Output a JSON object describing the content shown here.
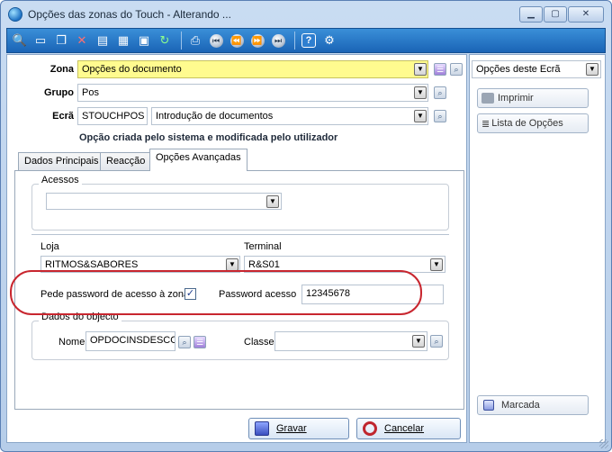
{
  "window": {
    "title": "Opções das zonas do Touch - Alterando ...",
    "minimize_glyph": "▁",
    "maximize_glyph": "▢",
    "close_glyph": "✕"
  },
  "toolbar": {
    "icons": [
      "search-icon",
      "new-document-icon",
      "copy-icon",
      "delete-icon",
      "properties-icon",
      "grid-icon",
      "export-icon",
      "refresh-icon",
      "print-preview-icon",
      "first-record-icon",
      "previous-record-icon",
      "next-record-icon",
      "last-record-icon",
      "help-icon",
      "settings-icon"
    ],
    "nav": {
      "first": "⏮",
      "prev": "⏪",
      "next": "⏩",
      "last": "⏭",
      "help": "?"
    }
  },
  "form": {
    "zona_label": "Zona",
    "zona_value": "Opções do documento",
    "grupo_label": "Grupo",
    "grupo_value": "Pos",
    "ecra_label": "Ecrã",
    "ecra_code": "STOUCHPOS",
    "ecra_value": "Introdução de documentos",
    "note": "Opção criada pelo sistema e modificada pelo utilizador"
  },
  "tabs": [
    {
      "label": "Dados Principais"
    },
    {
      "label": "Reacção"
    },
    {
      "label": "Opções Avançadas"
    }
  ],
  "advanced": {
    "acessos_title": "Acessos",
    "acessos_value": "",
    "loja_label": "Loja",
    "loja_value": "RITMOS&SABORES",
    "terminal_label": "Terminal",
    "terminal_value": "R&S01",
    "pede_password_label": "Pede password de acesso à zona",
    "pede_password_checked": true,
    "check_glyph": "✓",
    "password_label": "Password acesso",
    "password_value": "12345678",
    "objecto_title": "Dados do objecto",
    "nome_label": "Nome",
    "nome_value": "OPDOCINSDESCONT",
    "classe_label": "Classe",
    "classe_value": ""
  },
  "buttons": {
    "gravar": "Gravar",
    "cancelar": "Cancelar"
  },
  "right_panel": {
    "dropdown_value": "Opções deste Ecrã",
    "imprimir": "Imprimir",
    "lista_opcoes": "Lista de Opções",
    "marcada": "Marcada"
  },
  "colors": {
    "required_field": "#fffb8f",
    "toolbar": "#1a64b6",
    "annotation": "#c8262f"
  }
}
